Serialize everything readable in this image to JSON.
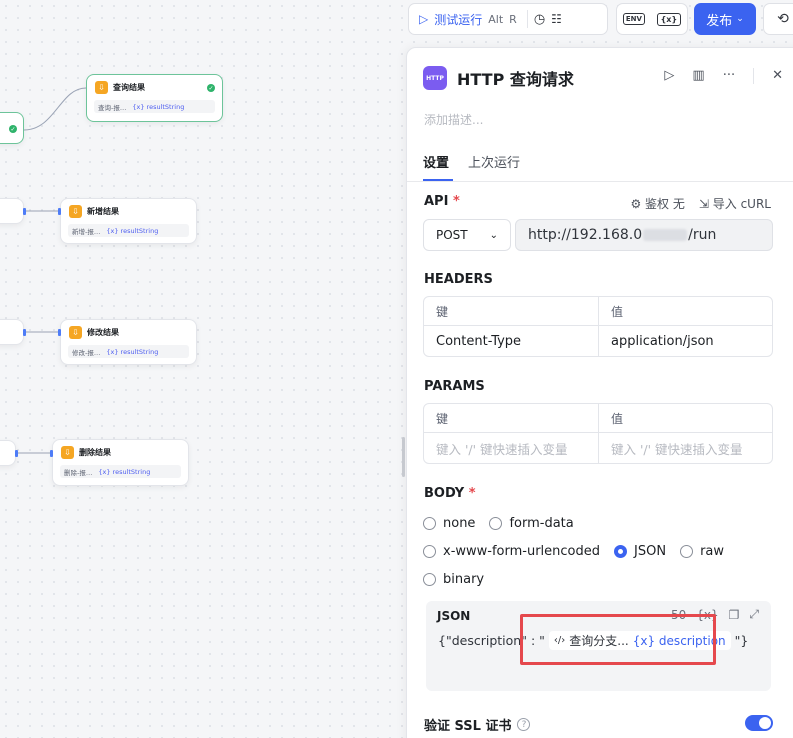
{
  "canvas": {
    "nodes": [
      {
        "title": "查询结果",
        "ref": "查询-报…",
        "var": "{x} resultString"
      },
      {
        "title": "新增结果",
        "ref": "新增-报…",
        "var": "{x} resultString"
      },
      {
        "title": "修改结果",
        "ref": "修改-报…",
        "var": "{x} resultString"
      },
      {
        "title": "删除结果",
        "ref": "删除-报…",
        "var": "{x} resultString"
      }
    ]
  },
  "toolbar": {
    "run_label": "测试运行",
    "run_shortcut_1": "Alt",
    "run_shortcut_2": "R",
    "env_label": "ENV",
    "var_label": "{x}",
    "publish_label": "发布",
    "icons": [
      "play-icon",
      "speed-icon",
      "checklist-icon",
      "env-icon",
      "variable-icon",
      "chevron-down-icon",
      "history-icon"
    ]
  },
  "panel": {
    "icon_text": "HTTP",
    "title": "HTTP 查询请求",
    "description_placeholder": "添加描述...",
    "tabs": [
      {
        "label": "设置"
      },
      {
        "label": "上次运行"
      }
    ],
    "api": {
      "label": "API",
      "required": "*",
      "auth_label": "鉴权 无",
      "import_label": "导入 cURL",
      "method": "POST",
      "url_prefix": "http://192.168.0",
      "url_suffix": "/run"
    },
    "headers": {
      "label": "HEADERS",
      "col_key": "键",
      "col_value": "值",
      "rows": [
        {
          "key": "Content-Type",
          "value": "application/json"
        }
      ]
    },
    "params": {
      "label": "PARAMS",
      "col_key": "键",
      "col_value": "值",
      "key_placeholder": "键入 '/' 键快速插入变量",
      "value_placeholder": "键入 '/' 键快速插入变量"
    },
    "body": {
      "label": "BODY",
      "required": "*",
      "options": [
        "none",
        "form-data",
        "x-www-form-urlencoded",
        "JSON",
        "raw",
        "binary"
      ],
      "selected": "JSON",
      "json": {
        "label": "JSON",
        "char_count": "50",
        "var_button": "{x}",
        "prefix": "{\"description\"",
        "colon": ":",
        "quote_open": "\"",
        "node_ref": "查询分支...",
        "var_ref": "{x} description",
        "quote_close": "\"}"
      }
    },
    "ssl": {
      "label": "验证 SSL 证书",
      "enabled": true
    }
  },
  "colors": {
    "accent": "#3b63f0",
    "highlight": "#e5484d",
    "node_icon": "#f5a623",
    "http_icon": "#7b5cf0"
  }
}
